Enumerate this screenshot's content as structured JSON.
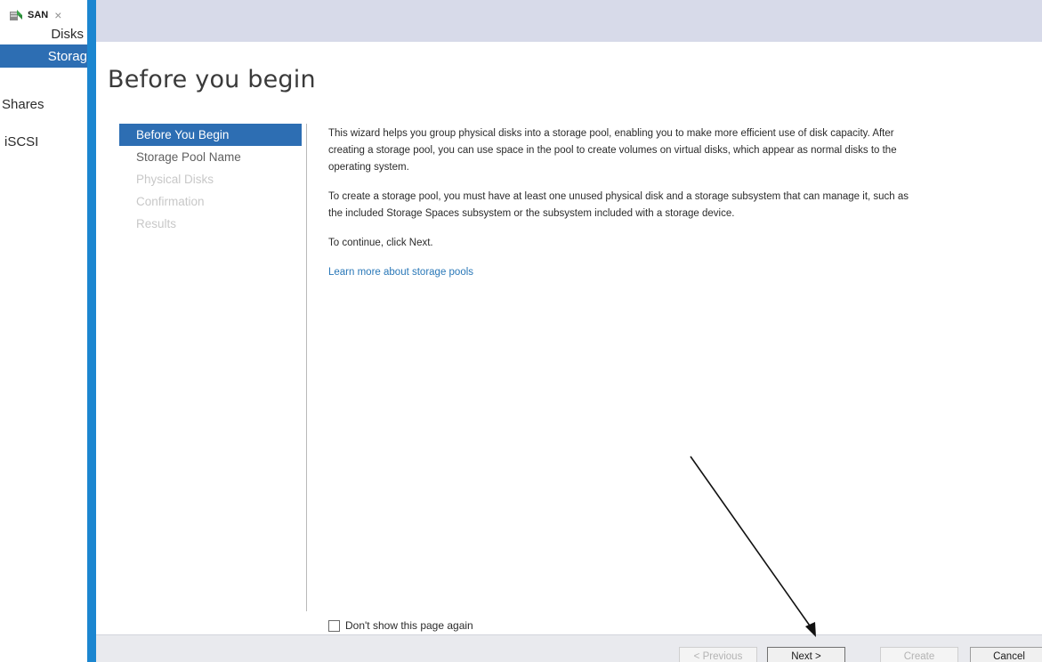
{
  "server_tab": {
    "label": "SAN",
    "close": "×"
  },
  "nav": {
    "disks": "Disks",
    "storage": "Storag",
    "shares": "Shares",
    "iscsi": "iSCSI"
  },
  "wizard": {
    "title": "Before you begin",
    "steps": [
      {
        "label": "Before You Begin",
        "state": "active"
      },
      {
        "label": "Storage Pool Name",
        "state": "enabled"
      },
      {
        "label": "Physical Disks",
        "state": "disabled"
      },
      {
        "label": "Confirmation",
        "state": "disabled"
      },
      {
        "label": "Results",
        "state": "disabled"
      }
    ],
    "paragraphs": [
      "This wizard helps you group physical disks into a storage pool, enabling you to make more efficient use of disk capacity. After\ncreating a storage pool, you can use space in the pool to create volumes on virtual disks, which appear as normal disks to the\noperating system.",
      "To create a storage pool, you must have at least one unused physical disk and a storage subsystem that can manage it, such as\nthe included Storage Spaces subsystem or the subsystem included with a storage device.",
      "To continue, click Next."
    ],
    "learn_more": "Learn more about storage pools",
    "dont_show_again": "Don't show this page again",
    "buttons": {
      "previous": "< Previous",
      "next": "Next >",
      "create": "Create",
      "cancel": "Cancel"
    }
  },
  "colors": {
    "accent_blue": "#1b86d0",
    "selected_blue": "#2d6eb3",
    "header_band": "#d7dae9",
    "link": "#2a78b8"
  }
}
